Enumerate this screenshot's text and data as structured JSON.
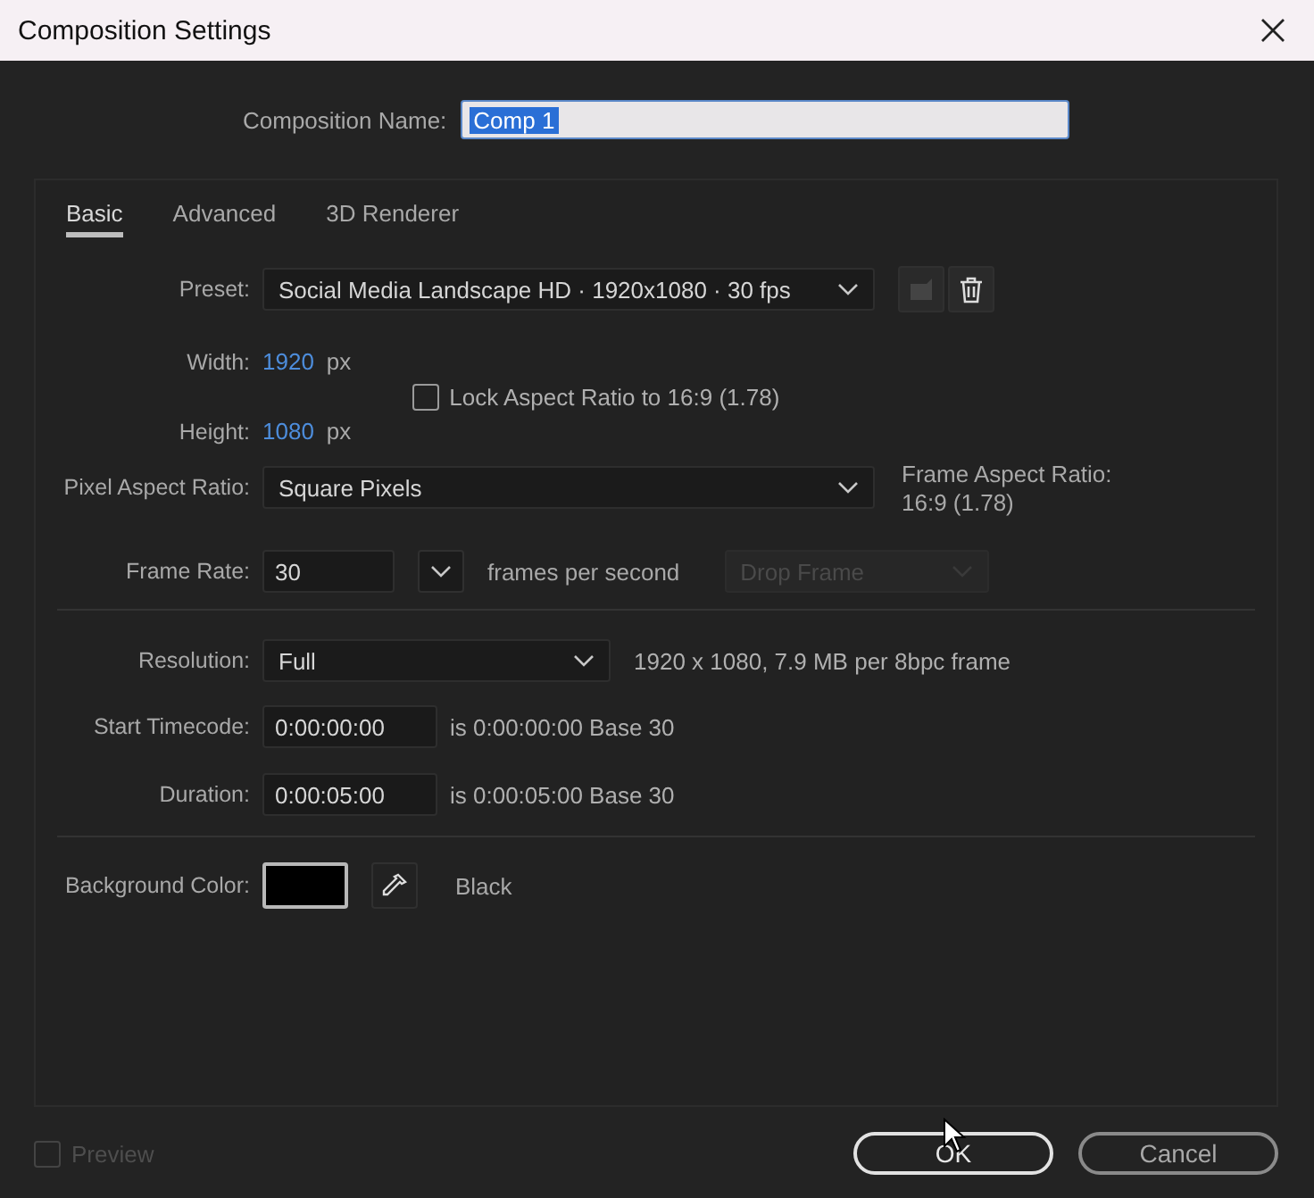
{
  "window": {
    "title": "Composition Settings"
  },
  "composition_name": {
    "label": "Composition Name:",
    "value": "Comp 1"
  },
  "tabs": [
    {
      "label": "Basic",
      "selected": true
    },
    {
      "label": "Advanced",
      "selected": false
    },
    {
      "label": "3D Renderer",
      "selected": false
    }
  ],
  "preset": {
    "label": "Preset:",
    "value": "Social Media Landscape HD  ·  1920x1080 · 30 fps"
  },
  "width": {
    "label": "Width:",
    "value": "1920",
    "unit": "px"
  },
  "height": {
    "label": "Height:",
    "value": "1080",
    "unit": "px"
  },
  "lock_aspect": {
    "label": "Lock Aspect Ratio to 16:9 (1.78)",
    "checked": false
  },
  "pixel_aspect": {
    "label": "Pixel Aspect Ratio:",
    "value": "Square Pixels"
  },
  "frame_aspect": {
    "label": "Frame Aspect Ratio:",
    "value": "16:9 (1.78)"
  },
  "frame_rate": {
    "label": "Frame Rate:",
    "value": "30",
    "unit": "frames per second"
  },
  "drop_frame": {
    "value": "Drop Frame",
    "disabled": true
  },
  "resolution": {
    "label": "Resolution:",
    "value": "Full",
    "info": "1920 x 1080, 7.9 MB  per 8bpc frame"
  },
  "start_timecode": {
    "label": "Start Timecode:",
    "value": "0:00:00:00",
    "info": "is 0:00:00:00  Base 30"
  },
  "duration": {
    "label": "Duration:",
    "value": "0:00:05:00",
    "info": "is 0:00:05:00  Base 30"
  },
  "background_color": {
    "label": "Background Color:",
    "color": "#000000",
    "name": "Black"
  },
  "preview": {
    "label": "Preview",
    "checked": false,
    "disabled": true
  },
  "buttons": [
    {
      "label": "OK",
      "kind": "primary"
    },
    {
      "label": "Cancel",
      "kind": "secondary"
    }
  ]
}
